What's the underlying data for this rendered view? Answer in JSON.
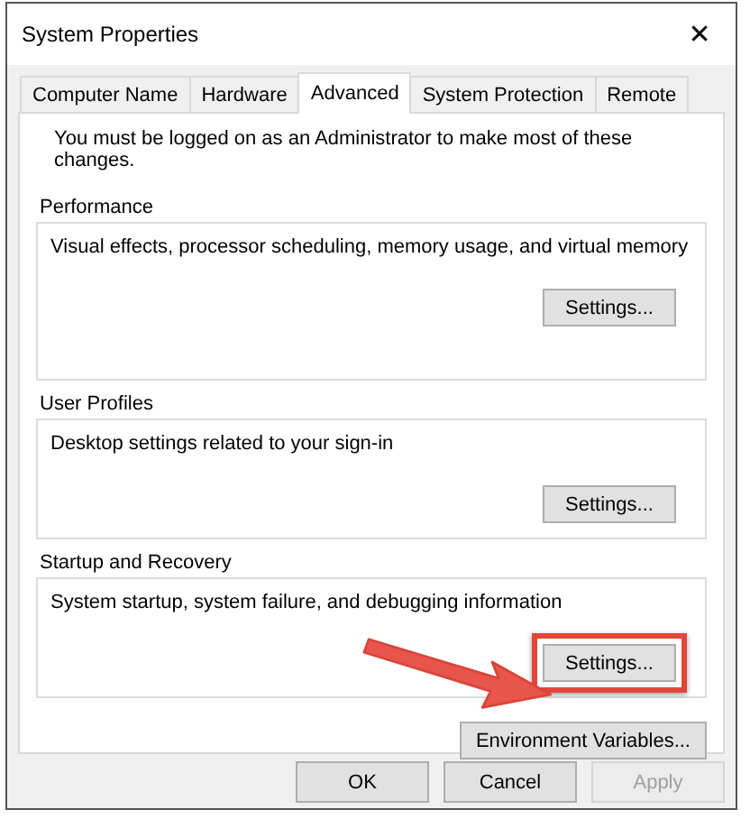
{
  "window": {
    "title": "System Properties",
    "close": "✕"
  },
  "tabs": [
    {
      "label": "Computer Name",
      "selected": false
    },
    {
      "label": "Hardware",
      "selected": false
    },
    {
      "label": "Advanced",
      "selected": true
    },
    {
      "label": "System Protection",
      "selected": false
    },
    {
      "label": "Remote",
      "selected": false
    }
  ],
  "notice": "You must be logged on as an Administrator to make most of these changes.",
  "groups": [
    {
      "title": "Performance",
      "description": "Visual effects, processor scheduling, memory usage, and virtual memory",
      "button": "Settings...",
      "highlighted": false
    },
    {
      "title": "User Profiles",
      "description": "Desktop settings related to your sign-in",
      "button": "Settings...",
      "highlighted": false
    },
    {
      "title": "Startup and Recovery",
      "description": "System startup, system failure, and debugging information",
      "button": "Settings...",
      "highlighted": true
    }
  ],
  "environment_button": "Environment Variables...",
  "buttons": [
    {
      "label": "OK",
      "disabled": false
    },
    {
      "label": "Cancel",
      "disabled": false
    },
    {
      "label": "Apply",
      "disabled": true
    }
  ]
}
